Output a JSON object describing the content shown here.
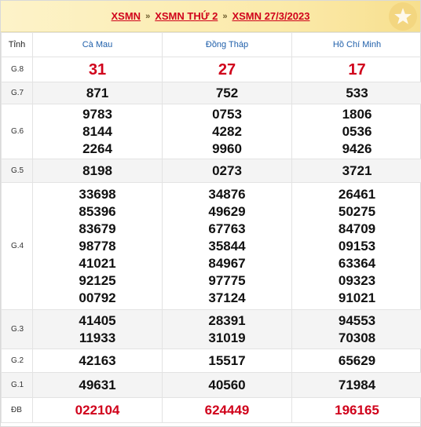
{
  "breadcrumb": {
    "items": [
      "XSMN",
      "XSMN THỨ 2",
      "XSMN 27/3/2023"
    ],
    "separator": "»"
  },
  "table": {
    "header": {
      "label": "Tỉnh",
      "provinces": [
        "Cà Mau",
        "Đồng Tháp",
        "Hồ Chí Minh"
      ]
    },
    "rows": [
      {
        "label": "G.8",
        "values": [
          [
            "31"
          ],
          [
            "27"
          ],
          [
            "17"
          ]
        ]
      },
      {
        "label": "G.7",
        "values": [
          [
            "871"
          ],
          [
            "752"
          ],
          [
            "533"
          ]
        ]
      },
      {
        "label": "G.6",
        "values": [
          [
            "9783",
            "8144",
            "2264"
          ],
          [
            "0753",
            "4282",
            "9960"
          ],
          [
            "1806",
            "0536",
            "9426"
          ]
        ]
      },
      {
        "label": "G.5",
        "values": [
          [
            "8198"
          ],
          [
            "0273"
          ],
          [
            "3721"
          ]
        ]
      },
      {
        "label": "G.4",
        "values": [
          [
            "33698",
            "85396",
            "83679",
            "98778",
            "41021",
            "92125",
            "00792"
          ],
          [
            "34876",
            "49629",
            "67763",
            "35844",
            "84967",
            "97775",
            "37124"
          ],
          [
            "26461",
            "50275",
            "84709",
            "09153",
            "63364",
            "09323",
            "91021"
          ]
        ]
      },
      {
        "label": "G.3",
        "values": [
          [
            "41405",
            "11933"
          ],
          [
            "28391",
            "31019"
          ],
          [
            "94553",
            "70308"
          ]
        ]
      },
      {
        "label": "G.2",
        "values": [
          [
            "42163"
          ],
          [
            "15517"
          ],
          [
            "65629"
          ]
        ]
      },
      {
        "label": "G.1",
        "values": [
          [
            "49631"
          ],
          [
            "40560"
          ],
          [
            "71984"
          ]
        ]
      },
      {
        "label": "ĐB",
        "values": [
          [
            "022104"
          ],
          [
            "624449"
          ],
          [
            "196165"
          ]
        ]
      }
    ]
  },
  "colors": {
    "accent_red": "#d0021b",
    "header_blue": "#1f5faa",
    "header_bg": "#fbe9a8"
  },
  "icons": {
    "badge": "star-icon"
  }
}
